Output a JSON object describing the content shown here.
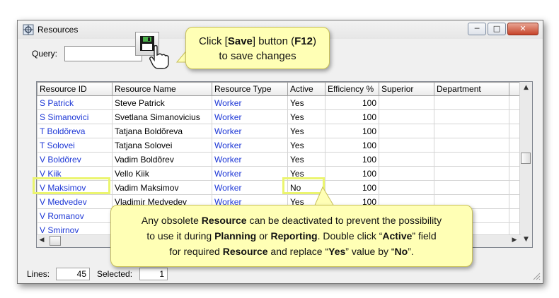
{
  "window": {
    "title": "Resources",
    "min_icon": "minimize-icon",
    "max_icon": "maximize-icon",
    "close_icon": "close-icon"
  },
  "query": {
    "label": "Query:",
    "value": ""
  },
  "toolbar": {
    "save_icon": "floppy-disk-icon"
  },
  "table": {
    "columns": [
      "Resource ID",
      "Resource Name",
      "Resource Type",
      "Active",
      "Efficiency %",
      "Superior",
      "Department"
    ],
    "rows": [
      {
        "id": "S Patrick",
        "name": "Steve Patrick",
        "type": "Worker",
        "active": "Yes",
        "eff": "100"
      },
      {
        "id": "S Simanovici",
        "name": "Svetlana Simanovicius",
        "type": "Worker",
        "active": "Yes",
        "eff": "100"
      },
      {
        "id": "T Boldõreva",
        "name": "Tatjana Boldõreva",
        "type": "Worker",
        "active": "Yes",
        "eff": "100"
      },
      {
        "id": "T Solovei",
        "name": "Tatjana Solovei",
        "type": "Worker",
        "active": "Yes",
        "eff": "100"
      },
      {
        "id": "V Boldõrev",
        "name": "Vadim Boldõrev",
        "type": "Worker",
        "active": "Yes",
        "eff": "100"
      },
      {
        "id": "V Kiik",
        "name": "Vello Kiik",
        "type": "Worker",
        "active": "Yes",
        "eff": "100"
      },
      {
        "id": "V Maksimov",
        "name": "Vadim Maksimov",
        "type": "Worker",
        "active": "No",
        "eff": "100"
      },
      {
        "id": "V Medvedev",
        "name": "Vladimir Medvedev",
        "type": "Worker",
        "active": "Yes",
        "eff": "100"
      },
      {
        "id": "V Romanov",
        "name": "",
        "type": "",
        "active": "",
        "eff": ""
      },
      {
        "id": "V Smirnov",
        "name": "",
        "type": "",
        "active": "",
        "eff": ""
      }
    ]
  },
  "status": {
    "lines_label": "Lines:",
    "lines_value": "45",
    "selected_label": "Selected:",
    "selected_value": "1"
  },
  "callout_save": {
    "line1_before": "Click [",
    "line1_bold": "Save",
    "line1_mid": "] button (",
    "line1_bold2": "F12",
    "line1_after": ")",
    "line2": "to save changes"
  },
  "callout_active": {
    "l1_a": "Any obsolete ",
    "l1_b": "Resource",
    "l1_c": " can be deactivated to prevent the possibility",
    "l2_a": "to use it during ",
    "l2_b": "Planning",
    "l2_c": " or ",
    "l2_d": "Reporting",
    "l2_e": ". Double click “",
    "l2_f": "Active",
    "l2_g": "” field",
    "l3_a": "for required ",
    "l3_b": "Resource",
    "l3_c": " and replace “",
    "l3_d": "Yes",
    "l3_e": "” value by “",
    "l3_f": "No",
    "l3_g": "”."
  },
  "colors": {
    "link": "#1d37d6",
    "callout_bg": "#ffffb5",
    "highlight": "#ebf56e",
    "close_btn": "#c7442a"
  }
}
